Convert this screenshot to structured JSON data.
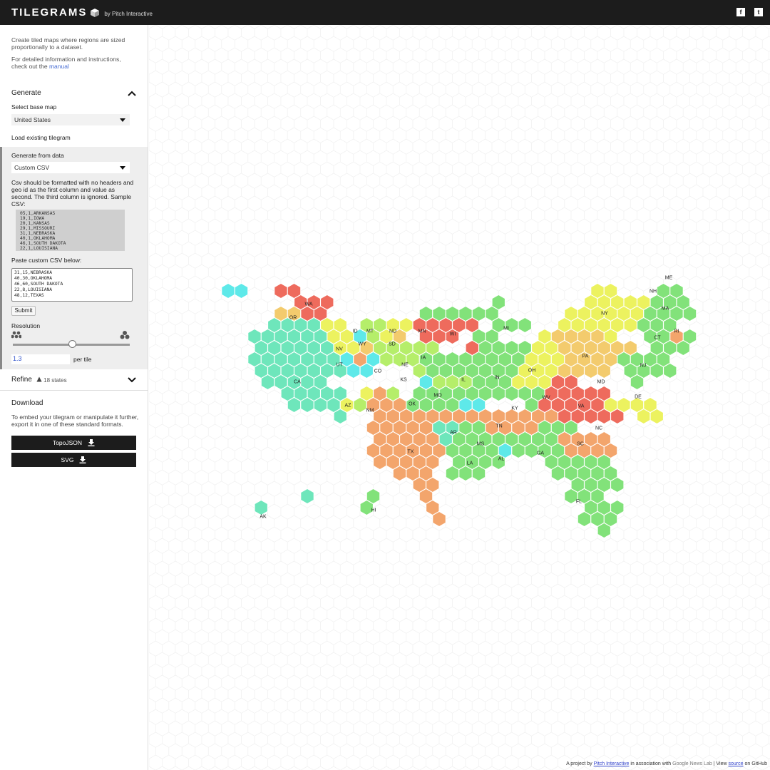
{
  "header": {
    "title": "TILEGRAMS",
    "by": "by Pitch Interactive",
    "facebook_icon": "f",
    "twitter_icon": "t"
  },
  "sidebar": {
    "intro1": "Create tiled maps where regions are sized proportionally to a dataset.",
    "intro2_prefix": "For detailed information and instructions, check out the",
    "intro2_link": "manual",
    "generate_title": "Generate",
    "base_map_label": "Select base map",
    "base_map_value": "United States",
    "load_existing": "Load existing tilegram",
    "from_data_label": "Generate from data",
    "data_source_value": "Custom CSV",
    "csv_help": "Csv should be formatted with no headers and geo id as the first column and value as second. The third column is ignored. Sample CSV:",
    "csv_sample": "05,1,ARKANSAS\n19,1,IOWA\n20,1,KANSAS\n29,1,MISSOURI\n31,1,NEBRASKA\n40,1,OKLAHOMA\n46,1,SOUTH DAKOTA\n22,1,LOUISIANA\n48,1,TEXAS",
    "paste_label": "Paste custom CSV below:",
    "csv_input": "31,15,NEBRASKA\n40,30,OKLAHOMA\n46,60,SOUTH DAKOTA\n22,8,LOUISIANA\n48,12,TEXAS",
    "submit_label": "Submit",
    "resolution_label": "Resolution",
    "resolution_fraction": 0.5,
    "tile_value": "1.3",
    "tile_unit": "per tile",
    "refine_title": "Refine",
    "refine_warning": "18 states",
    "download_title": "Download",
    "download_text": "To embed your tilegram or manipulate it further, export it in one of these standard formats.",
    "topojson_label": "TopoJSON",
    "svg_label": "SVG"
  },
  "footer": {
    "p1": "A project by",
    "link1": "Pitch Interactive",
    "p2": "in association with",
    "brand": "Google News Lab",
    "p3": "| View",
    "link2": "source",
    "p4": "on GitHub"
  },
  "map": {
    "colors": {
      "red": "#ee6b5d",
      "orange": "#f3a56c",
      "yellow": "#ecf25f",
      "lightorange": "#f3cb6d",
      "cyan": "#5ee9e9",
      "teal": "#6ee6bb",
      "green": "#82e27a",
      "lime": "#b5ee6a"
    },
    "labels": [
      "WA",
      "OR",
      "ID",
      "MT",
      "ND",
      "MN",
      "WI",
      "MI",
      "NY",
      "ME",
      "NH",
      "MA",
      "CT",
      "RI",
      "CA",
      "NV",
      "WY",
      "SD",
      "UT",
      "CO",
      "NE",
      "IA",
      "IL",
      "IN",
      "OH",
      "PA",
      "NJ",
      "MD",
      "DE",
      "KS",
      "MO",
      "KY",
      "WV",
      "VA",
      "AZ",
      "NM",
      "OK",
      "AR",
      "TN",
      "NC",
      "SC",
      "TX",
      "MS",
      "AL",
      "GA",
      "LA",
      "FL",
      "AK",
      "HI"
    ]
  }
}
